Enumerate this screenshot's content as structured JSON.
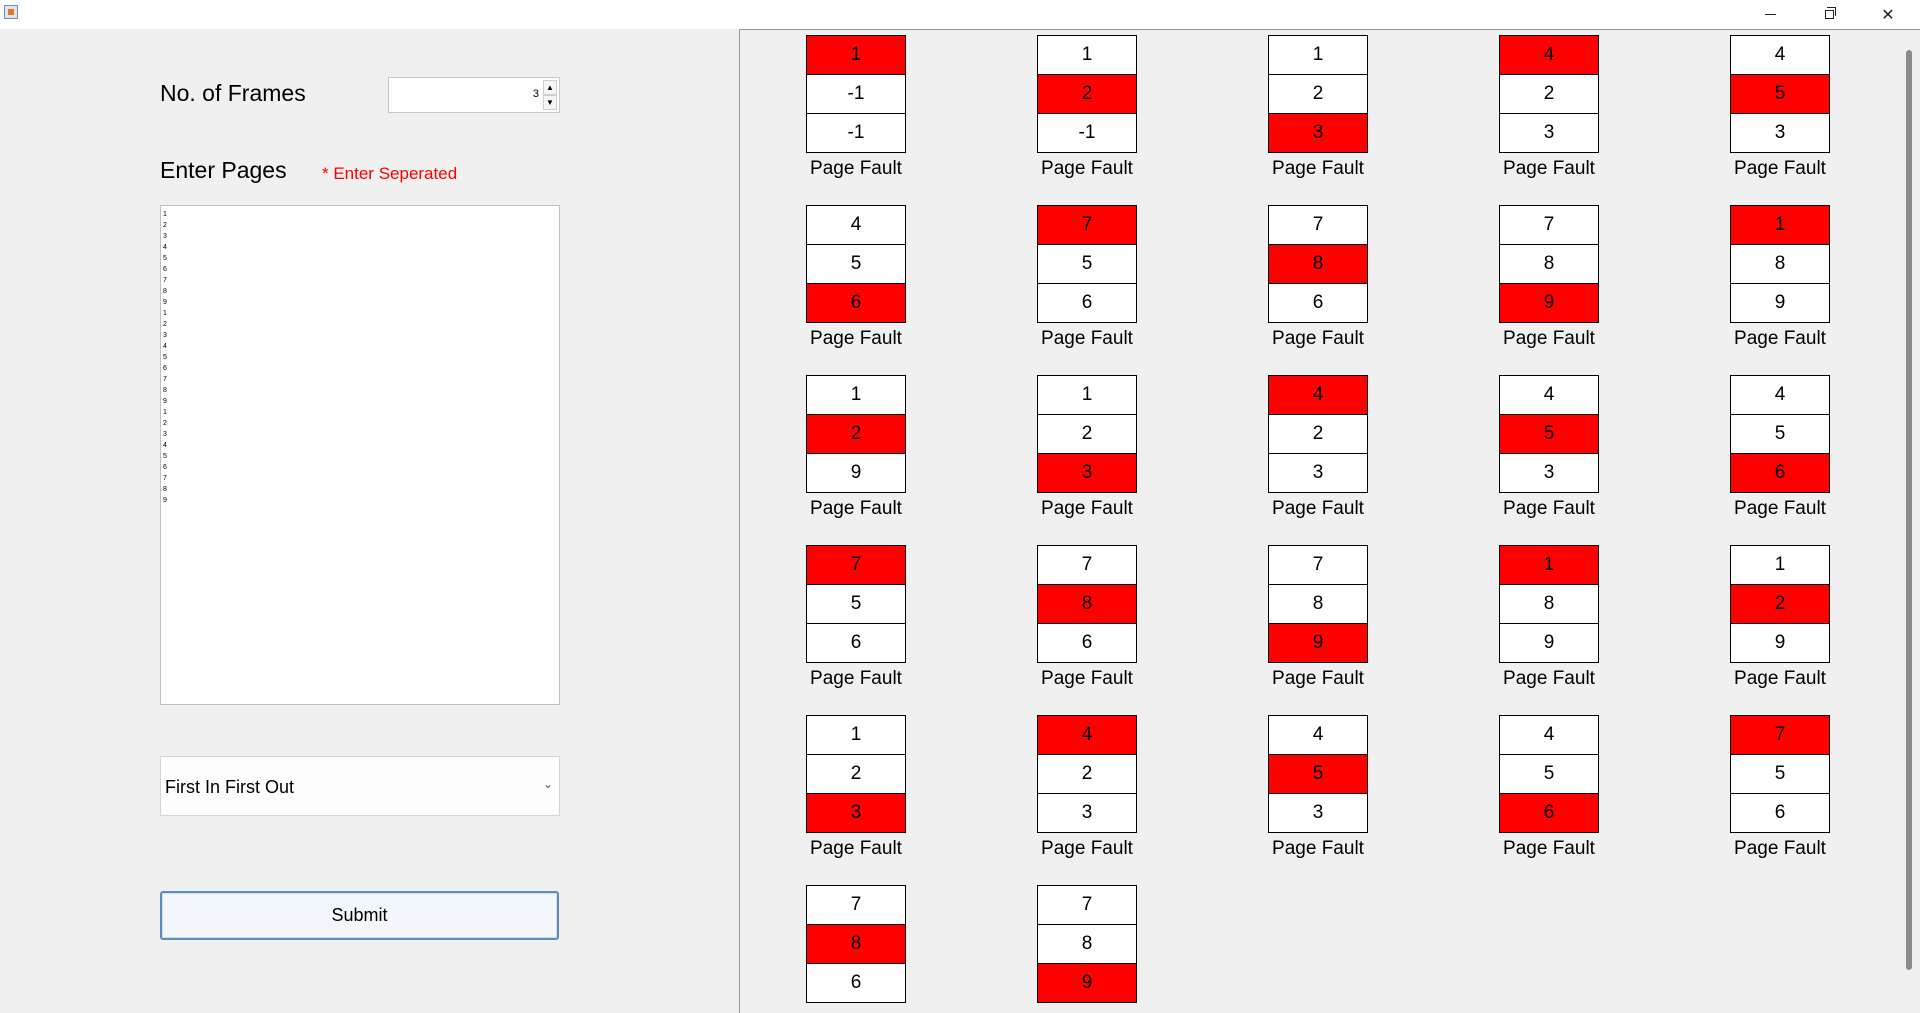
{
  "window": {
    "minimize_glyph": "minimize-icon",
    "maximize_glyph": "restore-icon",
    "close_glyph": "✕"
  },
  "form": {
    "frames_label": "No. of Frames",
    "frames_value": "3",
    "pages_label": "Enter Pages",
    "pages_hint": "* Enter Seperated",
    "pages": [
      "1",
      "2",
      "3",
      "4",
      "5",
      "6",
      "7",
      "8",
      "9",
      "1",
      "2",
      "3",
      "4",
      "5",
      "6",
      "7",
      "8",
      "9",
      "1",
      "2",
      "3",
      "4",
      "5",
      "6",
      "7",
      "8",
      "9"
    ],
    "algorithm": "First In First Out",
    "submit_label": "Submit"
  },
  "colors": {
    "fault_highlight": "#ff0000",
    "hint_text": "#ff0000"
  },
  "result": {
    "fault_label": "Page Fault",
    "steps": [
      {
        "frames": [
          "1",
          "-1",
          "-1"
        ],
        "highlight": 0,
        "fault": true
      },
      {
        "frames": [
          "1",
          "2",
          "-1"
        ],
        "highlight": 1,
        "fault": true
      },
      {
        "frames": [
          "1",
          "2",
          "3"
        ],
        "highlight": 2,
        "fault": true
      },
      {
        "frames": [
          "4",
          "2",
          "3"
        ],
        "highlight": 0,
        "fault": true
      },
      {
        "frames": [
          "4",
          "5",
          "3"
        ],
        "highlight": 1,
        "fault": true
      },
      {
        "frames": [
          "4",
          "5",
          "6"
        ],
        "highlight": 2,
        "fault": true
      },
      {
        "frames": [
          "7",
          "5",
          "6"
        ],
        "highlight": 0,
        "fault": true
      },
      {
        "frames": [
          "7",
          "8",
          "6"
        ],
        "highlight": 1,
        "fault": true
      },
      {
        "frames": [
          "7",
          "8",
          "9"
        ],
        "highlight": 2,
        "fault": true
      },
      {
        "frames": [
          "1",
          "8",
          "9"
        ],
        "highlight": 0,
        "fault": true
      },
      {
        "frames": [
          "1",
          "2",
          "9"
        ],
        "highlight": 1,
        "fault": true
      },
      {
        "frames": [
          "1",
          "2",
          "3"
        ],
        "highlight": 2,
        "fault": true
      },
      {
        "frames": [
          "4",
          "2",
          "3"
        ],
        "highlight": 0,
        "fault": true
      },
      {
        "frames": [
          "4",
          "5",
          "3"
        ],
        "highlight": 1,
        "fault": true
      },
      {
        "frames": [
          "4",
          "5",
          "6"
        ],
        "highlight": 2,
        "fault": true
      },
      {
        "frames": [
          "7",
          "5",
          "6"
        ],
        "highlight": 0,
        "fault": true
      },
      {
        "frames": [
          "7",
          "8",
          "6"
        ],
        "highlight": 1,
        "fault": true
      },
      {
        "frames": [
          "7",
          "8",
          "9"
        ],
        "highlight": 2,
        "fault": true
      },
      {
        "frames": [
          "1",
          "8",
          "9"
        ],
        "highlight": 0,
        "fault": true
      },
      {
        "frames": [
          "1",
          "2",
          "9"
        ],
        "highlight": 1,
        "fault": true
      },
      {
        "frames": [
          "1",
          "2",
          "3"
        ],
        "highlight": 2,
        "fault": true
      },
      {
        "frames": [
          "4",
          "2",
          "3"
        ],
        "highlight": 0,
        "fault": true
      },
      {
        "frames": [
          "4",
          "5",
          "3"
        ],
        "highlight": 1,
        "fault": true
      },
      {
        "frames": [
          "4",
          "5",
          "6"
        ],
        "highlight": 2,
        "fault": true
      },
      {
        "frames": [
          "7",
          "5",
          "6"
        ],
        "highlight": 0,
        "fault": true
      },
      {
        "frames": [
          "7",
          "8",
          "6"
        ],
        "highlight": 1,
        "fault": false
      },
      {
        "frames": [
          "7",
          "8",
          "9"
        ],
        "highlight": 2,
        "fault": false
      }
    ]
  }
}
